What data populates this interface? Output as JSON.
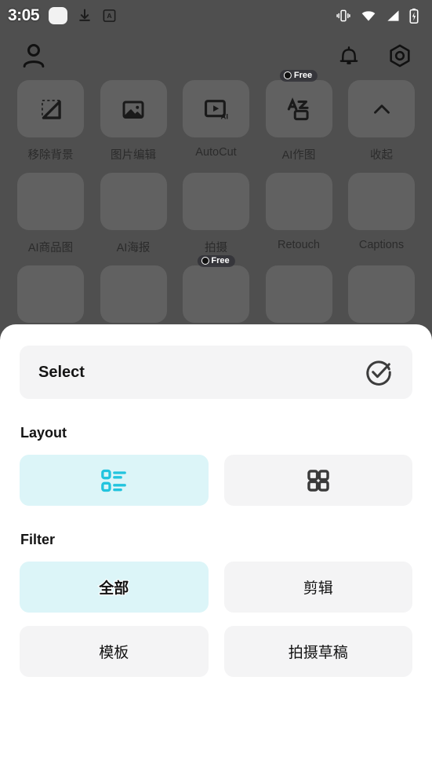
{
  "status_bar": {
    "time": "3:05",
    "left_icons": [
      "rounded-blob-icon",
      "download-icon",
      "a-badge-icon"
    ],
    "right_icons": [
      "vibrate-icon",
      "wifi-icon",
      "signal-icon",
      "battery-icon"
    ]
  },
  "app": {
    "topbar": {
      "profile_icon": "person-icon",
      "notifications_icon": "bell-icon",
      "settings_icon": "hex-gear-icon"
    },
    "tools": {
      "rows": [
        [
          {
            "label": "移除背景",
            "icon": "remove-background-icon",
            "badge": ""
          },
          {
            "label": "图片编辑",
            "icon": "image-edit-icon",
            "badge": ""
          },
          {
            "label": "AutoCut",
            "icon": "autocut-ai-icon",
            "badge": ""
          },
          {
            "label": "AI作图",
            "icon": "ai-text-image-icon",
            "badge": "Free"
          },
          {
            "label": "收起",
            "icon": "chevron-up-icon",
            "badge": ""
          }
        ],
        [
          {
            "label": "AI商品图",
            "icon": "ai-product-image-icon",
            "badge": ""
          },
          {
            "label": "AI海报",
            "icon": "ai-poster-icon",
            "badge": ""
          },
          {
            "label": "拍摄",
            "icon": "camera-icon",
            "badge": ""
          },
          {
            "label": "Retouch",
            "icon": "retouch-icon",
            "badge": ""
          },
          {
            "label": "Captions",
            "icon": "captions-icon",
            "badge": ""
          }
        ],
        [
          {
            "label": "",
            "icon": "tool-icon",
            "badge": ""
          },
          {
            "label": "",
            "icon": "tool-icon",
            "badge": ""
          },
          {
            "label": "",
            "icon": "tool-icon",
            "badge": "Free"
          },
          {
            "label": "",
            "icon": "tool-icon",
            "badge": ""
          },
          {
            "label": "",
            "icon": "tool-icon",
            "badge": ""
          }
        ]
      ]
    }
  },
  "sheet": {
    "select": {
      "label": "Select",
      "icon": "check-circle-icon"
    },
    "layout": {
      "title": "Layout",
      "options": [
        {
          "name": "list-view",
          "icon": "list-view-icon",
          "selected": true
        },
        {
          "name": "grid-view",
          "icon": "grid-view-icon",
          "selected": false
        }
      ]
    },
    "filter": {
      "title": "Filter",
      "options": [
        {
          "label": "全部",
          "selected": true
        },
        {
          "label": "剪辑",
          "selected": false
        },
        {
          "label": "模板",
          "selected": false
        },
        {
          "label": "拍摄草稿",
          "selected": false
        }
      ]
    }
  },
  "colors": {
    "accent_cyan": "#22c4de",
    "selected_bg": "#dcf5f8",
    "neutral_bg": "#f4f4f5",
    "text_dark": "#141414"
  }
}
